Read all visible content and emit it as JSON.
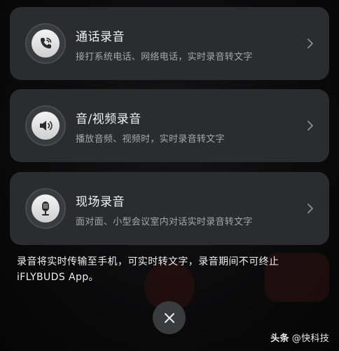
{
  "options": [
    {
      "title": "通话录音",
      "subtitle": "接打系统电话、网络电话，实时录音转文字",
      "icon": "phone-icon"
    },
    {
      "title": "音/视频录音",
      "subtitle": "播放音频、视频时，实时录音转文字",
      "icon": "speaker-icon"
    },
    {
      "title": "现场录音",
      "subtitle": "面对面、小型会议室内对话实时录音转文字",
      "icon": "microphone-icon"
    }
  ],
  "notice": {
    "line1": "录音将实时传输至手机，可实时转文字，录音期间不可终止",
    "line2": "iFLYBUDS App。"
  },
  "close": {
    "icon": "close-icon"
  },
  "watermark": {
    "logo": "头条",
    "account": "@快科技"
  },
  "colors": {
    "card": "#2b2c2f",
    "background": "#070708",
    "text_primary": "#f2f2f2",
    "text_secondary": "#a6a7ab"
  }
}
